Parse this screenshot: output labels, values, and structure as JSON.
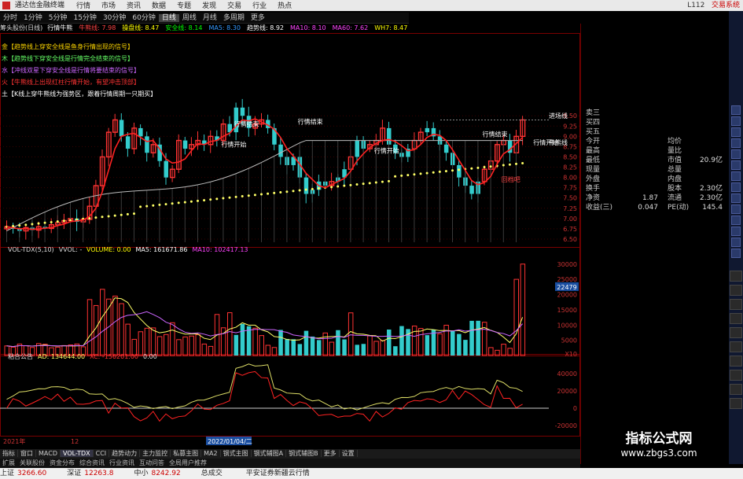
{
  "app": {
    "title": "通达信金融终端",
    "system_text": "L112",
    "right_title": "交易系统"
  },
  "menu": [
    "行情",
    "市场",
    "资讯",
    "数据",
    "专题",
    "发现",
    "交易",
    "行业",
    "热点"
  ],
  "period_tabs": [
    "分时",
    "1分钟",
    "5分钟",
    "15分钟",
    "30分钟",
    "60分钟",
    "日线",
    "周线",
    "月线",
    "多周期",
    "更多"
  ],
  "active_period": "日线",
  "stock_header": {
    "name": "筹头股份(日线)",
    "items": [
      {
        "label": "行情牛熊",
        "color": "#ffffff"
      },
      {
        "label": "牛熊线: 7.98",
        "color": "#ff4444"
      },
      {
        "label": "操盘线: 8.47",
        "color": "#ffff00"
      },
      {
        "label": "安全线: 8.14",
        "color": "#00ff00"
      },
      {
        "label": "MA5: 8.30",
        "color": "#3399ff"
      },
      {
        "label": "趋势线: 8.92",
        "color": "#ffffff"
      },
      {
        "label": "MA10: 8.10",
        "color": "#ff44ff"
      },
      {
        "label": "MA60: 7.62",
        "color": "#ff44ff"
      },
      {
        "label": "WH7: 8.47",
        "color": "#ffff00"
      }
    ]
  },
  "signals": [
    {
      "text": "金【趋势线上穿安全线是鱼身行情出现的信号】",
      "color": "#ffd700"
    },
    {
      "text": "木【趋势线下穿安全线是行情完全结束的信号】",
      "color": "#66ff66"
    },
    {
      "text": "水【冲线双星下穿安全线是行情将要结束的信号】",
      "color": "#cc66ff"
    },
    {
      "text": "火【牛熊线上出现红柱行情开始，有望冲击顶部】",
      "color": "#ff3333"
    },
    {
      "text": "土【K线上穿牛熊线为强势区，跟着行情周期一只期买】",
      "color": "#ffffff"
    }
  ],
  "price_axis": [
    "9.50",
    "9.25",
    "9.00",
    "8.75",
    "8.50",
    "8.25",
    "8.00",
    "7.75",
    "7.50",
    "7.25",
    "7.00",
    "6.75",
    "6.50"
  ],
  "annotations": [
    "行情结束",
    "行情开始",
    "行情结束",
    "行情开始",
    "行情结束",
    "进场线",
    "行情开始",
    "牛熊线",
    "回档吧"
  ],
  "volume_header": {
    "name": "VOL-TDX(5,10)",
    "vvol": "VVOL: -",
    "volume": "VOLUME: 0.00",
    "ma5": "MA5: 161671.86",
    "ma10": "MA10: 102417.13"
  },
  "volume_axis": [
    "30000",
    "25000",
    "20000",
    "15000",
    "10000",
    "5000",
    "X10"
  ],
  "volume_badge": "22479",
  "ad_header": {
    "name": "粘合公告",
    "ad": "AD: 134644.00",
    "xc": "XC: -156201.00",
    "zero": "0.00"
  },
  "ad_axis": [
    "40000",
    "20000",
    "0",
    "-20000"
  ],
  "date_axis": {
    "left": "2021年",
    "mid": "12",
    "highlight": "2022/01/04/二"
  },
  "quote_panel": {
    "rows": [
      {
        "l": "卖三",
        "v": "",
        "l2": "",
        "v2": ""
      },
      {
        "l": "买四",
        "v": "",
        "l2": "",
        "v2": ""
      },
      {
        "l": "买五",
        "v": "",
        "l2": "",
        "v2": ""
      },
      {
        "l": "今开",
        "v": "",
        "l2": "均价",
        "v2": ""
      },
      {
        "l": "最高",
        "v": "",
        "l2": "量比",
        "v2": ""
      },
      {
        "l": "最低",
        "v": "",
        "l2": "市值",
        "v2": "20.9亿"
      },
      {
        "l": "现量",
        "v": "",
        "l2": "总量",
        "v2": ""
      },
      {
        "l": "外盘",
        "v": "",
        "l2": "内盘",
        "v2": ""
      },
      {
        "l": "换手",
        "v": "",
        "l2": "股本",
        "v2": "2.30亿"
      },
      {
        "l": "净资",
        "v": "1.87",
        "l2": "流通",
        "v2": "2.30亿"
      },
      {
        "l": "收益(三)",
        "v": "0.047",
        "l2": "PE(动)",
        "v2": "145.4"
      }
    ]
  },
  "formula_tabs": [
    "指标",
    "窗口",
    "MACD",
    "VOL-TDX",
    "CCI",
    "趋势动力",
    "主力监控",
    "私募主图",
    "MA2",
    "钢式主图",
    "钢式辅图A",
    "钢式辅图B",
    "更多",
    "设置"
  ],
  "active_formula_tab": "VOL-TDX",
  "sub_tabs": [
    "扩展",
    "关联股份",
    "资金分布",
    "综合资讯",
    "行业资讯",
    "互动问答",
    "全局用户推荐"
  ],
  "status": [
    {
      "label": "上证",
      "value": "3266.60"
    },
    {
      "label": "深证",
      "value": "12263.8"
    },
    {
      "label": "中小",
      "value": "8242.92"
    },
    {
      "label": "总成交",
      "value": ""
    },
    {
      "label": "平安证券新疆云行情",
      "value": ""
    }
  ],
  "watermark": {
    "line1": "指标公式网",
    "line2": "www.zbgs3.com"
  },
  "colors": {
    "up": "#ff3333",
    "down": "#33cccc",
    "bull_bear": "#ffff66",
    "bg": "#000000",
    "grid": "#600000"
  }
}
